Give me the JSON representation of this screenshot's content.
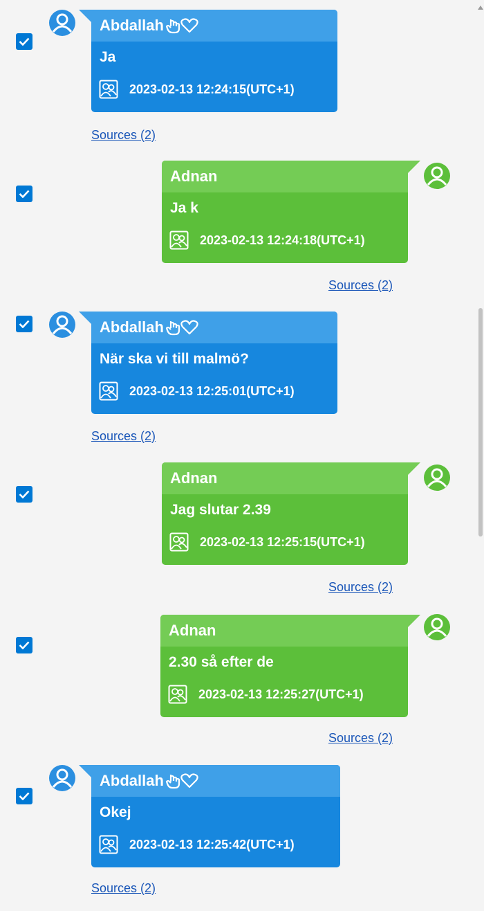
{
  "colors": {
    "received_bubble": "#1787de",
    "received_header": "#3fa0e8",
    "sent_bubble": "#5cbf3a",
    "sent_header": "#74cc55",
    "avatar_received": "#2b8fe0",
    "avatar_sent": "#5cbf3a",
    "link": "#1a56b8",
    "checkbox": "#0078d4"
  },
  "messages": [
    {
      "sender": "Abdallah",
      "direction": "received",
      "text": "Ja",
      "timestamp": "2023-02-13 12:24:15(UTC+1)",
      "sources": "Sources (2)",
      "checked": true,
      "icons": [
        "hand-pointer-icon",
        "heart-icon"
      ]
    },
    {
      "sender": "Adnan",
      "direction": "sent",
      "text": "Ja k",
      "timestamp": "2023-02-13 12:24:18(UTC+1)",
      "sources": "Sources (2)",
      "checked": true
    },
    {
      "sender": "Abdallah",
      "direction": "received",
      "text": "När ska vi till malmö?",
      "timestamp": "2023-02-13 12:25:01(UTC+1)",
      "sources": "Sources (2)",
      "checked": true,
      "icons": [
        "hand-pointer-icon",
        "heart-icon"
      ]
    },
    {
      "sender": "Adnan",
      "direction": "sent",
      "text": "Jag slutar 2.39",
      "timestamp": "2023-02-13 12:25:15(UTC+1)",
      "sources": "Sources (2)",
      "checked": true
    },
    {
      "sender": "Adnan",
      "direction": "sent",
      "text": "2.30 så efter de",
      "timestamp": "2023-02-13 12:25:27(UTC+1)",
      "sources": "Sources (2)",
      "checked": true
    },
    {
      "sender": "Abdallah",
      "direction": "received",
      "text": "Okej",
      "timestamp": "2023-02-13 12:25:42(UTC+1)",
      "sources": "Sources (2)",
      "checked": true,
      "icons": [
        "hand-pointer-icon",
        "heart-icon"
      ]
    }
  ]
}
